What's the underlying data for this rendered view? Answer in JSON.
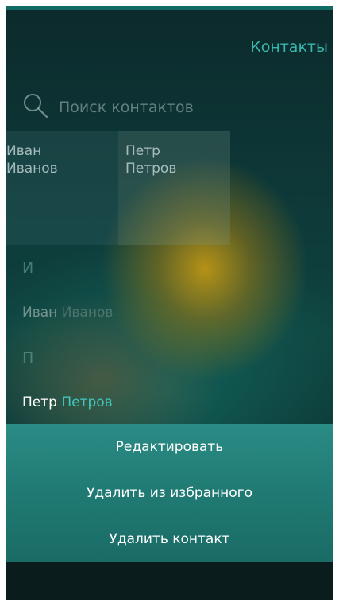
{
  "header": {
    "title": "Контакты"
  },
  "search": {
    "placeholder": "Поиск контактов"
  },
  "favorites": [
    {
      "first": "Иван",
      "last": "Иванов"
    },
    {
      "first": "Петр",
      "last": "Петров"
    }
  ],
  "sections": [
    {
      "letter": "И",
      "contact": {
        "first": "Иван",
        "last": "Иванов"
      }
    },
    {
      "letter": "П",
      "contact": {
        "first": "Петр",
        "last": "Петров"
      }
    }
  ],
  "context_menu": {
    "items": [
      "Редактировать",
      "Удалить из избранного",
      "Удалить контакт"
    ]
  },
  "colors": {
    "accent": "#3ab6ad",
    "menu": "#207a73"
  }
}
